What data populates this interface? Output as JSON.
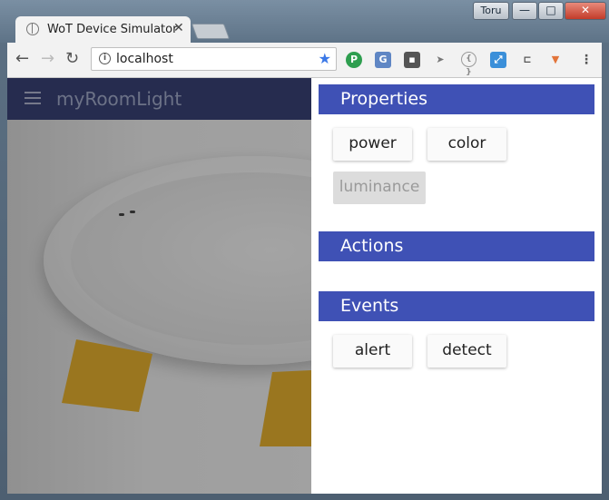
{
  "browser": {
    "user": "Toru",
    "tab_title": "WoT Device Simulator",
    "url": "localhost",
    "window_controls": {
      "minimize": "—",
      "maximize": "□",
      "close": "✕"
    },
    "icons": [
      "back-icon",
      "forward-icon",
      "reload-icon",
      "info-icon",
      "star-icon"
    ]
  },
  "app": {
    "title": "myRoomLight"
  },
  "drawer": {
    "properties": {
      "heading": "Properties",
      "items": [
        {
          "label": "power",
          "enabled": true
        },
        {
          "label": "color",
          "enabled": true
        },
        {
          "label": "luminance",
          "enabled": false
        }
      ]
    },
    "actions": {
      "heading": "Actions",
      "items": []
    },
    "events": {
      "heading": "Events",
      "items": [
        {
          "label": "alert",
          "enabled": true
        },
        {
          "label": "detect",
          "enabled": true
        }
      ]
    }
  },
  "colors": {
    "accent": "#3f51b5",
    "appbar": "#25306a",
    "light_beam": "#e6aa1a"
  }
}
